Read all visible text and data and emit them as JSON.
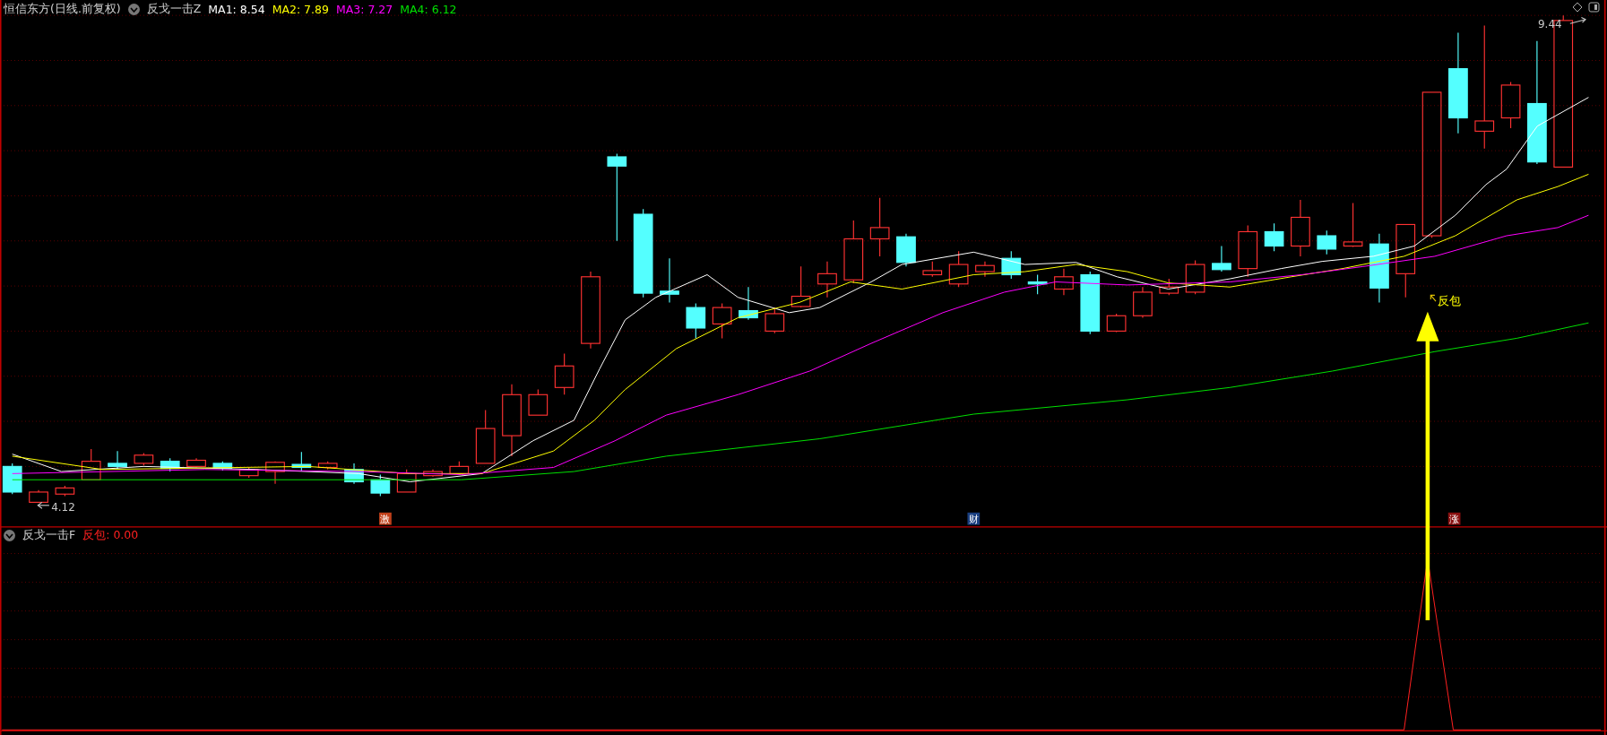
{
  "header": {
    "title": "恒信东方(日线.前复权)",
    "indicator": "反戈一击Z",
    "ma": [
      {
        "label": "MA1: 8.54",
        "color": "#ffffff"
      },
      {
        "label": "MA2: 7.89",
        "color": "#ffff00"
      },
      {
        "label": "MA3: 7.27",
        "color": "#ff00ff"
      },
      {
        "label": "MA4: 6.12",
        "color": "#00e000"
      }
    ]
  },
  "price_labels": {
    "high": "9.44",
    "low": "4.12"
  },
  "signal_label": "反包",
  "event_markers": [
    {
      "text": "激",
      "color": "#c0401a"
    },
    {
      "text": "财",
      "color": "#1a3f80"
    },
    {
      "text": "涨",
      "color": "#8a1010"
    }
  ],
  "sub_pane": {
    "indicator": "反戈一击F",
    "value_label": "反包: 0.00"
  }
}
